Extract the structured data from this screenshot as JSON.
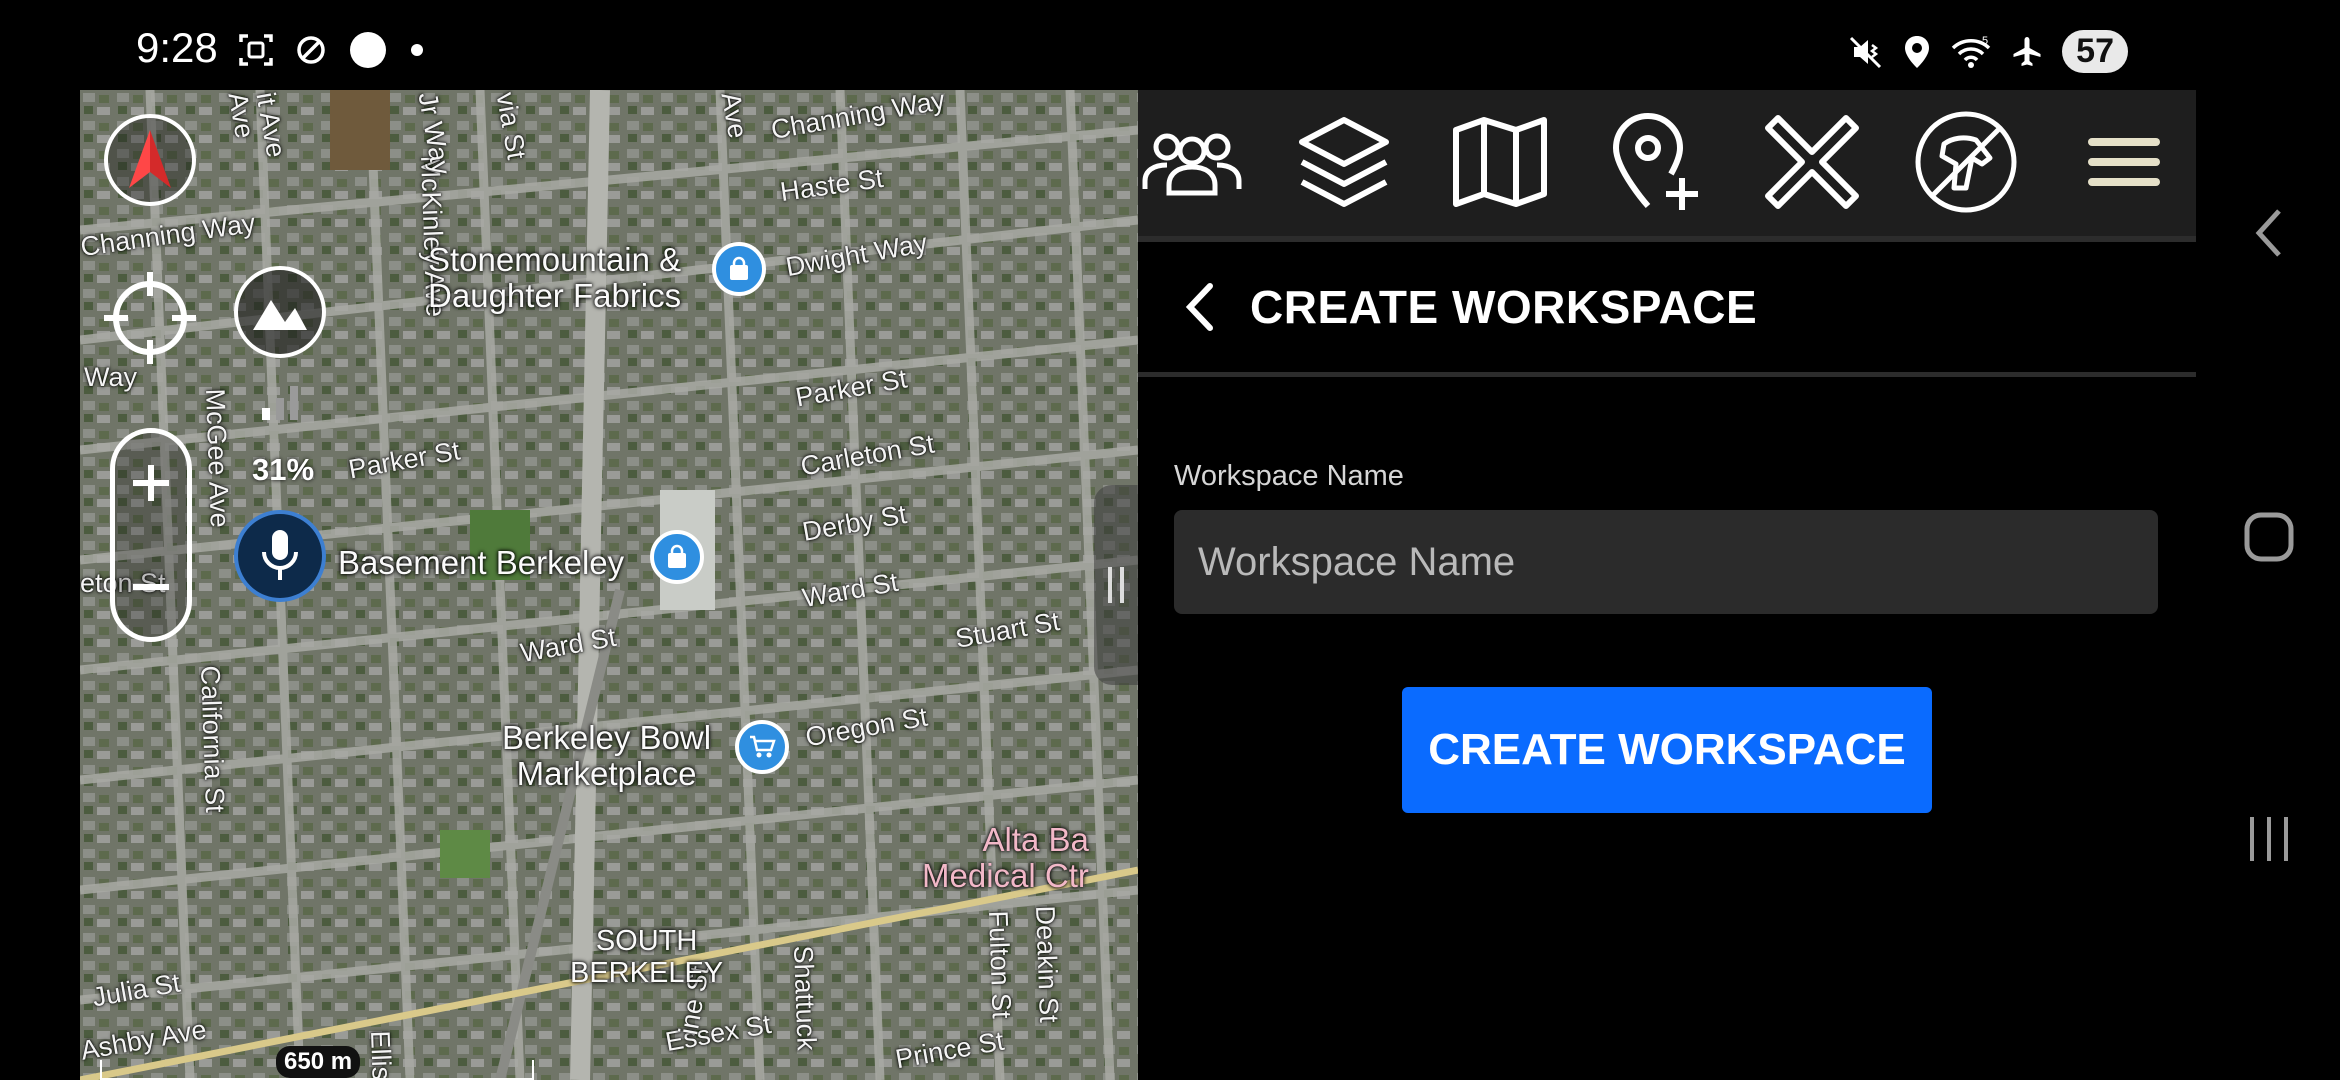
{
  "status_bar": {
    "time": "9:28",
    "battery": "57",
    "icons": [
      "screenshot-icon",
      "dnd-icon",
      "circle-icon",
      "dot-icon",
      "mute-icon",
      "location-icon",
      "wifi-icon",
      "airplane-icon"
    ]
  },
  "map": {
    "battery_percent": "31%",
    "scale_label": "650 m",
    "streets": [
      "Channing Way",
      "Haste St",
      "Dwight Way",
      "Parker St",
      "Carleton St",
      "Derby St",
      "Ward St",
      "Stuart St",
      "Oregon St",
      "Channing Way",
      "Way",
      "Parker St",
      "Ward St",
      "McKinley Ave",
      "California St",
      "Julia St",
      "Ashby Ave",
      "Essex St",
      "Prince St",
      "Fulton St",
      "Deakin St",
      "Shattuck",
      "ine St",
      "Jr Way",
      "via St",
      "Ave",
      "it Ave",
      "McGee Ave",
      "Ave",
      "eton St",
      "Ellis"
    ],
    "places": {
      "fabrics": "Stonemountain &\nDaughter Fabrics",
      "basement": "Basement Berkeley",
      "bowl": "Berkeley Bowl\nMarketplace",
      "medical": "Alta Ba\nMedical Ctr",
      "south": "SOUTH\nBERKELEY"
    },
    "colors": {
      "pin": "#2f8fe0",
      "control_dark": "#0d2a4a"
    }
  },
  "toolbar": {
    "icons": [
      "team-icon",
      "layers-icon",
      "map-icon",
      "add-location-icon",
      "close-icon",
      "dog-icon",
      "menu-icon"
    ]
  },
  "panel": {
    "title": "CREATE WORKSPACE",
    "field_label": "Workspace Name",
    "field_placeholder": "Workspace Name",
    "field_value": "",
    "button_label": "CREATE WORKSPACE",
    "accent": "#0a6bff"
  }
}
